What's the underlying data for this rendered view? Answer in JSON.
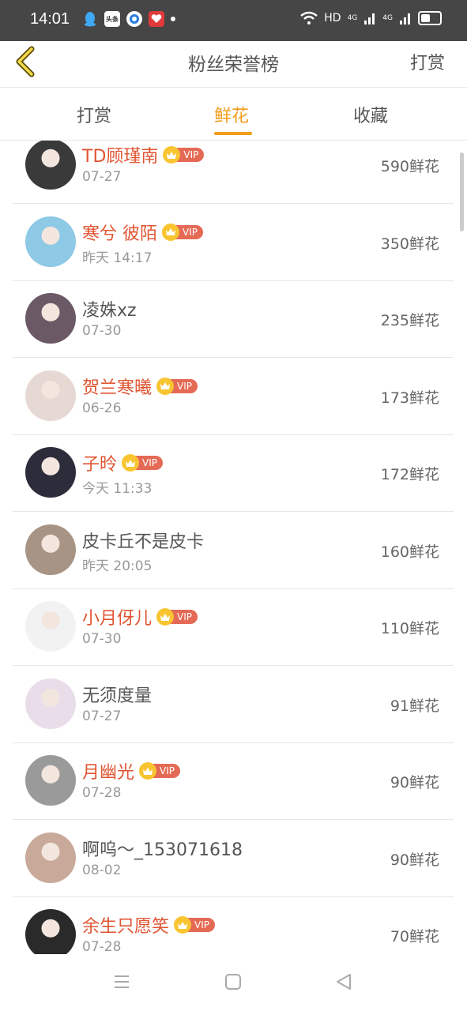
{
  "status_bar": {
    "time": "14:01",
    "left_icons": [
      "qq-icon",
      "toutiao-icon",
      "browser-icon",
      "heart-app-icon",
      "notification-dot"
    ],
    "toutiao_label": "头条",
    "network": "HD",
    "signal1": "4G",
    "signal2": "4G",
    "battery": "battery-icon"
  },
  "header": {
    "back_icon": "chevron-left-icon",
    "title": "粉丝荣誉榜",
    "right_label": "打赏"
  },
  "tabs": {
    "items": [
      {
        "label": "打赏"
      },
      {
        "label": "鲜花"
      },
      {
        "label": "收藏"
      }
    ],
    "active_index": 1
  },
  "vip_label": "VIP",
  "list": [
    {
      "name": "TD顾瑾南",
      "date": "07-27",
      "count": "590鲜花",
      "vip": true,
      "avatar_color": "#3a3a3a"
    },
    {
      "name": "寒兮 彼陌",
      "date": "昨天 14:17",
      "count": "350鲜花",
      "vip": true,
      "avatar_color": "#8ec9e6"
    },
    {
      "name": "凌姝xz",
      "date": "07-30",
      "count": "235鲜花",
      "vip": false,
      "avatar_color": "#6b5a66"
    },
    {
      "name": "贺兰寒曦",
      "date": "06-26",
      "count": "173鲜花",
      "vip": true,
      "avatar_color": "#e6d8d2"
    },
    {
      "name": "子昤",
      "date": "今天 11:33",
      "count": "172鲜花",
      "vip": true,
      "avatar_color": "#2c2c3a"
    },
    {
      "name": "皮卡丘不是皮卡",
      "date": "昨天 20:05",
      "count": "160鲜花",
      "vip": false,
      "avatar_color": "#a89484"
    },
    {
      "name": "小月伢儿",
      "date": "07-30",
      "count": "110鲜花",
      "vip": true,
      "avatar_color": "#f2f2f2"
    },
    {
      "name": "无须度量",
      "date": "07-27",
      "count": "91鲜花",
      "vip": false,
      "avatar_color": "#e8dde8"
    },
    {
      "name": "月幽光",
      "date": "07-28",
      "count": "90鲜花",
      "vip": true,
      "avatar_color": "#9a9a9a"
    },
    {
      "name": "啊呜～_153071618",
      "date": "08-02",
      "count": "90鲜花",
      "vip": false,
      "avatar_color": "#c9aa9a"
    },
    {
      "name": "余生只愿笑",
      "date": "07-28",
      "count": "70鲜花",
      "vip": true,
      "avatar_color": "#2a2a2a"
    }
  ],
  "nav": {
    "menu_icon": "menu-icon",
    "home_icon": "home-square-icon",
    "back_icon": "back-triangle-icon"
  },
  "colors": {
    "accent": "#f19d1a",
    "vip_name": "#e05532",
    "vip_badge": "#e46a55",
    "crown": "#f8c531",
    "status_bar": "#464646"
  }
}
